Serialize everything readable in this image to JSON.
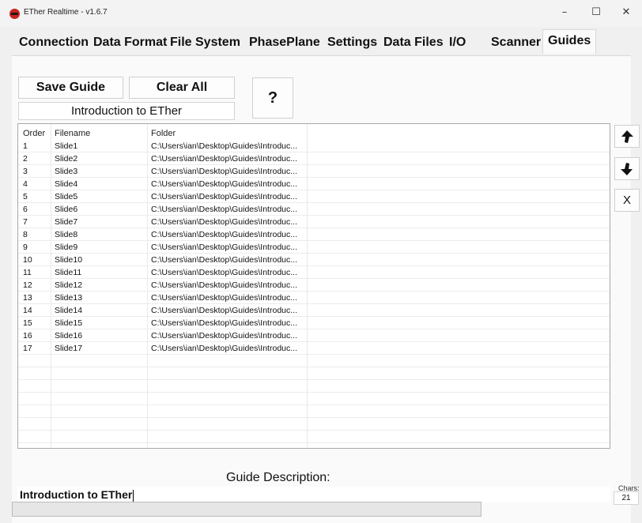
{
  "window": {
    "title": "ETher Realtime - v1.6.7",
    "controls": {
      "minimize": "–",
      "maximize": "☐",
      "close": "✕"
    }
  },
  "tabs": [
    {
      "label": "Connection"
    },
    {
      "label": "Data Format"
    },
    {
      "label": "File System"
    },
    {
      "label": "PhasePlane"
    },
    {
      "label": "Settings"
    },
    {
      "label": "Data Files"
    },
    {
      "label": "I/O"
    },
    {
      "label": "Scanner"
    },
    {
      "label": "Guides",
      "active": true
    }
  ],
  "toolbar": {
    "save_label": "Save Guide",
    "clear_label": "Clear All",
    "help_label": "?",
    "guide_name": "Introduction to ETher"
  },
  "list": {
    "columns": [
      "Order",
      "Filename",
      "Folder"
    ],
    "rows": [
      [
        "1",
        "Slide1",
        "C:\\Users\\ian\\Desktop\\Guides\\Introduc..."
      ],
      [
        "2",
        "Slide2",
        "C:\\Users\\ian\\Desktop\\Guides\\Introduc..."
      ],
      [
        "3",
        "Slide3",
        "C:\\Users\\ian\\Desktop\\Guides\\Introduc..."
      ],
      [
        "4",
        "Slide4",
        "C:\\Users\\ian\\Desktop\\Guides\\Introduc..."
      ],
      [
        "5",
        "Slide5",
        "C:\\Users\\ian\\Desktop\\Guides\\Introduc..."
      ],
      [
        "6",
        "Slide6",
        "C:\\Users\\ian\\Desktop\\Guides\\Introduc..."
      ],
      [
        "7",
        "Slide7",
        "C:\\Users\\ian\\Desktop\\Guides\\Introduc..."
      ],
      [
        "8",
        "Slide8",
        "C:\\Users\\ian\\Desktop\\Guides\\Introduc..."
      ],
      [
        "9",
        "Slide9",
        "C:\\Users\\ian\\Desktop\\Guides\\Introduc..."
      ],
      [
        "10",
        "Slide10",
        "C:\\Users\\ian\\Desktop\\Guides\\Introduc..."
      ],
      [
        "11",
        "Slide11",
        "C:\\Users\\ian\\Desktop\\Guides\\Introduc..."
      ],
      [
        "12",
        "Slide12",
        "C:\\Users\\ian\\Desktop\\Guides\\Introduc..."
      ],
      [
        "13",
        "Slide13",
        "C:\\Users\\ian\\Desktop\\Guides\\Introduc..."
      ],
      [
        "14",
        "Slide14",
        "C:\\Users\\ian\\Desktop\\Guides\\Introduc..."
      ],
      [
        "15",
        "Slide15",
        "C:\\Users\\ian\\Desktop\\Guides\\Introduc..."
      ],
      [
        "16",
        "Slide16",
        "C:\\Users\\ian\\Desktop\\Guides\\Introduc..."
      ],
      [
        "17",
        "Slide17",
        "C:\\Users\\ian\\Desktop\\Guides\\Introduc..."
      ]
    ],
    "empty_rows": 7
  },
  "side_buttons": {
    "up_icon": "arrow-up-icon",
    "down_icon": "arrow-down-icon",
    "remove_label": "X"
  },
  "description": {
    "label": "Guide Description:",
    "value": "Introduction to ETher",
    "chars_label": "Chars:",
    "chars_count": "21"
  },
  "progress": {
    "fraction": 0.0
  },
  "colors": {
    "progress_fill": "#06b025",
    "app_icon": "#c8231f"
  }
}
